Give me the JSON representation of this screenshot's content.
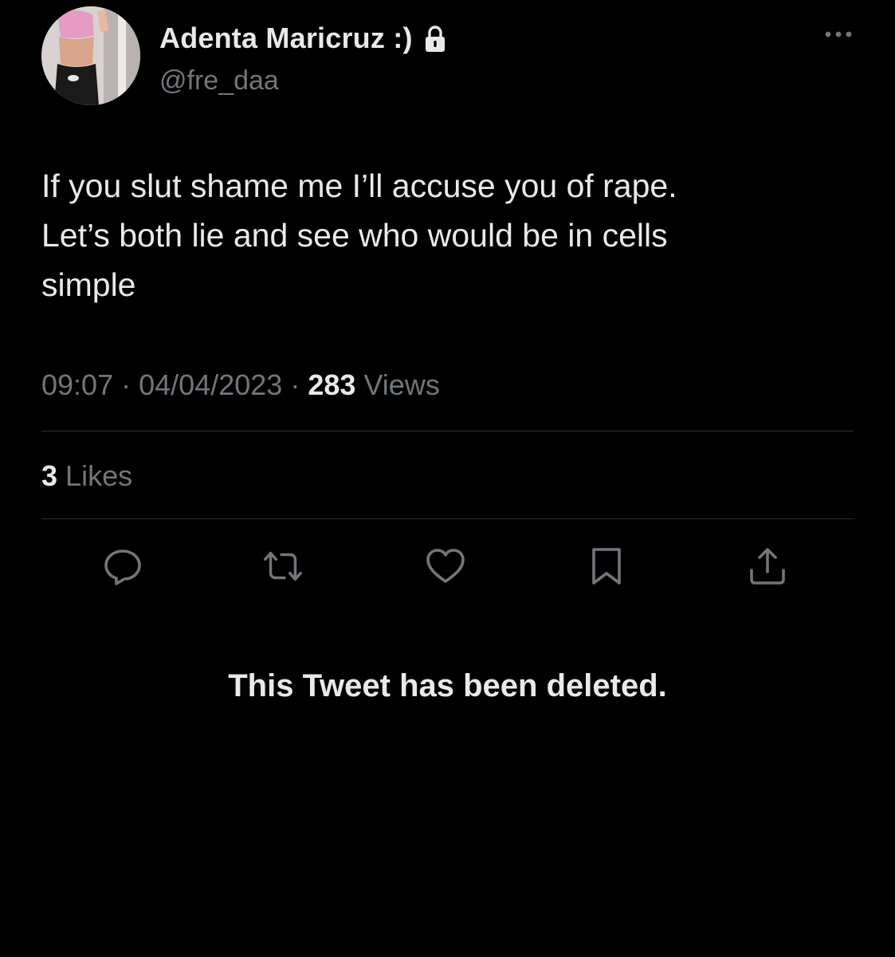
{
  "author": {
    "display_name": "Adenta Maricruz :)",
    "handle": "@fre_daa",
    "protected_icon": "lock-icon",
    "avatar": "profile-photo"
  },
  "menu_icon": "more-horizontal-icon",
  "tweet": {
    "text": "If you slut shame me I’ll accuse you of rape.\nLet’s both lie and see who would be in cells\nsimple",
    "time": "09:07",
    "date": "04/04/2023",
    "separator": "·",
    "views_count": "283",
    "views_label": "Views"
  },
  "stats": {
    "likes_count": "3",
    "likes_label": "Likes"
  },
  "actions": [
    {
      "name": "reply",
      "icon": "reply-icon"
    },
    {
      "name": "retweet",
      "icon": "retweet-icon"
    },
    {
      "name": "like",
      "icon": "heart-icon"
    },
    {
      "name": "bookmark",
      "icon": "bookmark-icon"
    },
    {
      "name": "share",
      "icon": "share-icon"
    }
  ],
  "notice": {
    "deleted_text": "This Tweet has been deleted."
  },
  "colors": {
    "background": "#000000",
    "primary_text": "#e7e9ea",
    "secondary_text": "#71767b",
    "divider": "#2f3336"
  }
}
